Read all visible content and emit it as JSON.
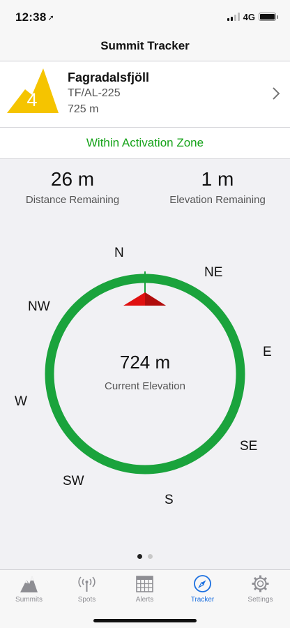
{
  "status_bar": {
    "time": "12:38",
    "location_arrow": "➚",
    "network": "4G",
    "battery_level": 1.0
  },
  "nav": {
    "title": "Summit Tracker"
  },
  "summit": {
    "points": "4",
    "name": "Fagradalsfjöll",
    "reference": "TF/AL-225",
    "height": "725 m",
    "badge_color": "#f5c400"
  },
  "zone": {
    "status": "Within Activation Zone",
    "color": "#16a31a"
  },
  "stats": {
    "distance_value": "26 m",
    "distance_label": "Distance Remaining",
    "elevation_value": "1 m",
    "elevation_label": "Elevation Remaining"
  },
  "compass": {
    "directions": {
      "n": "N",
      "ne": "NE",
      "e": "E",
      "se": "SE",
      "s": "S",
      "sw": "SW",
      "w": "W",
      "nw": "NW"
    },
    "current_elevation_value": "724 m",
    "current_elevation_label": "Current Elevation",
    "ring_color": "#1aa33c",
    "pointer_color": "#e01010"
  },
  "pager": {
    "pages": 2,
    "current": 1
  },
  "tabs": [
    {
      "label": "Summits",
      "icon": "mountain-icon",
      "active": false
    },
    {
      "label": "Spots",
      "icon": "antenna-icon",
      "active": false
    },
    {
      "label": "Alerts",
      "icon": "calendar-grid-icon",
      "active": false
    },
    {
      "label": "Tracker",
      "icon": "compass-icon",
      "active": true
    },
    {
      "label": "Settings",
      "icon": "gear-icon",
      "active": false
    }
  ]
}
